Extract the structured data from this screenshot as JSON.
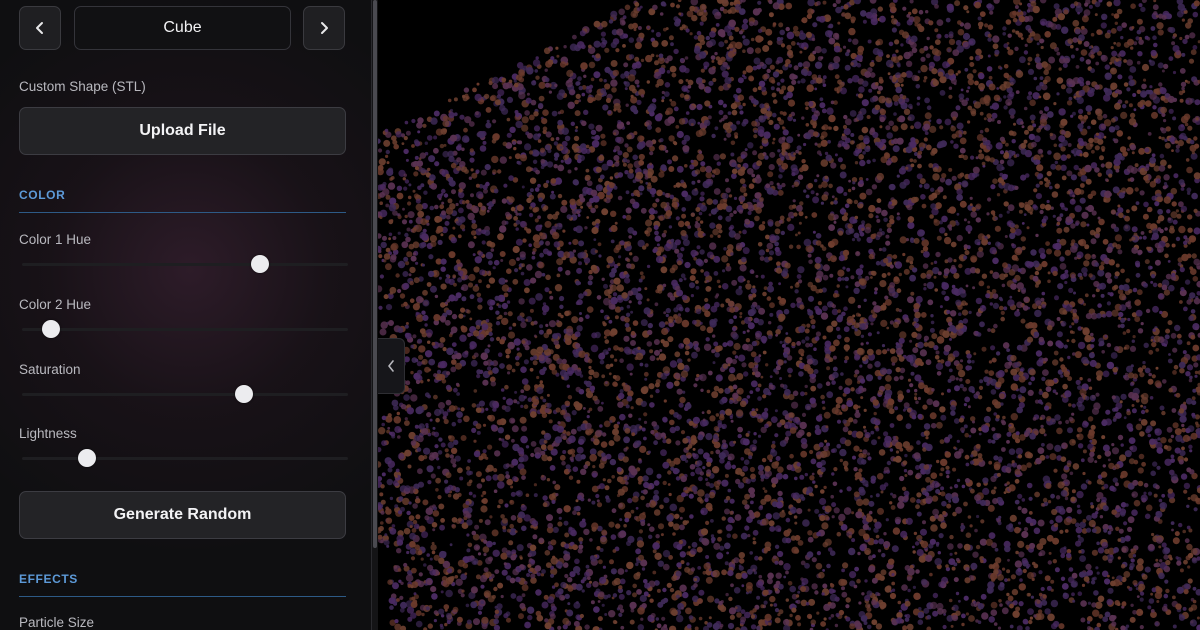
{
  "shape_selector": {
    "current_shape": "Cube",
    "prev_icon": "chevron-left-icon",
    "next_icon": "chevron-right-icon"
  },
  "custom_shape": {
    "label": "Custom Shape (STL)",
    "upload_label": "Upload File"
  },
  "color_section": {
    "title": "COLOR",
    "sliders": [
      {
        "label": "Color 1 Hue",
        "value": 0.73
      },
      {
        "label": "Color 2 Hue",
        "value": 0.09
      },
      {
        "label": "Saturation",
        "value": 0.68
      },
      {
        "label": "Lightness",
        "value": 0.2
      }
    ],
    "random_label": "Generate Random"
  },
  "effects_section": {
    "title": "EFFECTS",
    "particle_size_label": "Particle Size"
  },
  "viewport": {
    "collapse_icon": "chevron-left-icon",
    "particle_colors": [
      "#6b3a2c",
      "#4a2a62",
      "#5a3252",
      "#3f2a58",
      "#6e4030"
    ]
  },
  "colors": {
    "accent": "#5d9ad8",
    "panel_bg": "#0f0f11"
  }
}
